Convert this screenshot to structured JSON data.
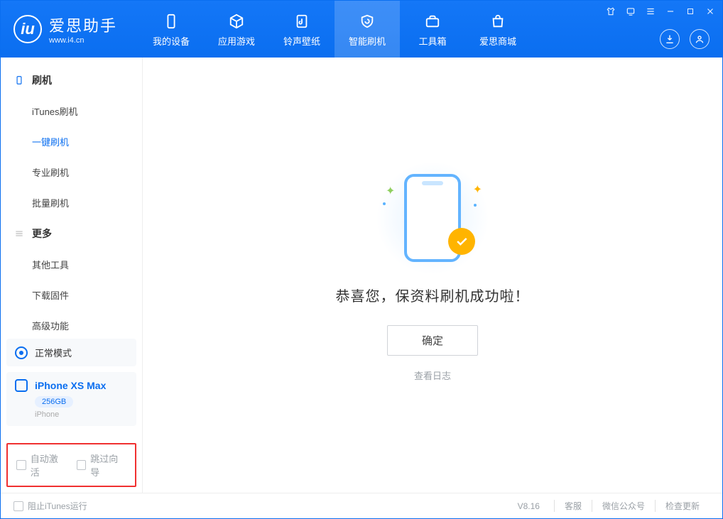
{
  "app": {
    "title": "爱思助手",
    "subtitle": "www.i4.cn"
  },
  "nav": {
    "my_device": "我的设备",
    "apps_games": "应用游戏",
    "ring_wall": "铃声壁纸",
    "smart_flash": "智能刷机",
    "toolbox": "工具箱",
    "store": "爱思商城"
  },
  "sidebar": {
    "group_flash": "刷机",
    "items_flash": [
      "iTunes刷机",
      "一键刷机",
      "专业刷机",
      "批量刷机"
    ],
    "group_more": "更多",
    "items_more": [
      "其他工具",
      "下载固件",
      "高级功能"
    ],
    "mode_label": "正常模式",
    "device": {
      "name": "iPhone XS Max",
      "capacity": "256GB",
      "type": "iPhone"
    },
    "cb_auto_activate": "自动激活",
    "cb_skip_guide": "跳过向导"
  },
  "main": {
    "success_text": "恭喜您，保资料刷机成功啦！",
    "ok_button": "确定",
    "view_log": "查看日志"
  },
  "footer": {
    "block_itunes": "阻止iTunes运行",
    "version": "V8.16",
    "support": "客服",
    "wechat": "微信公众号",
    "check_update": "检查更新"
  }
}
